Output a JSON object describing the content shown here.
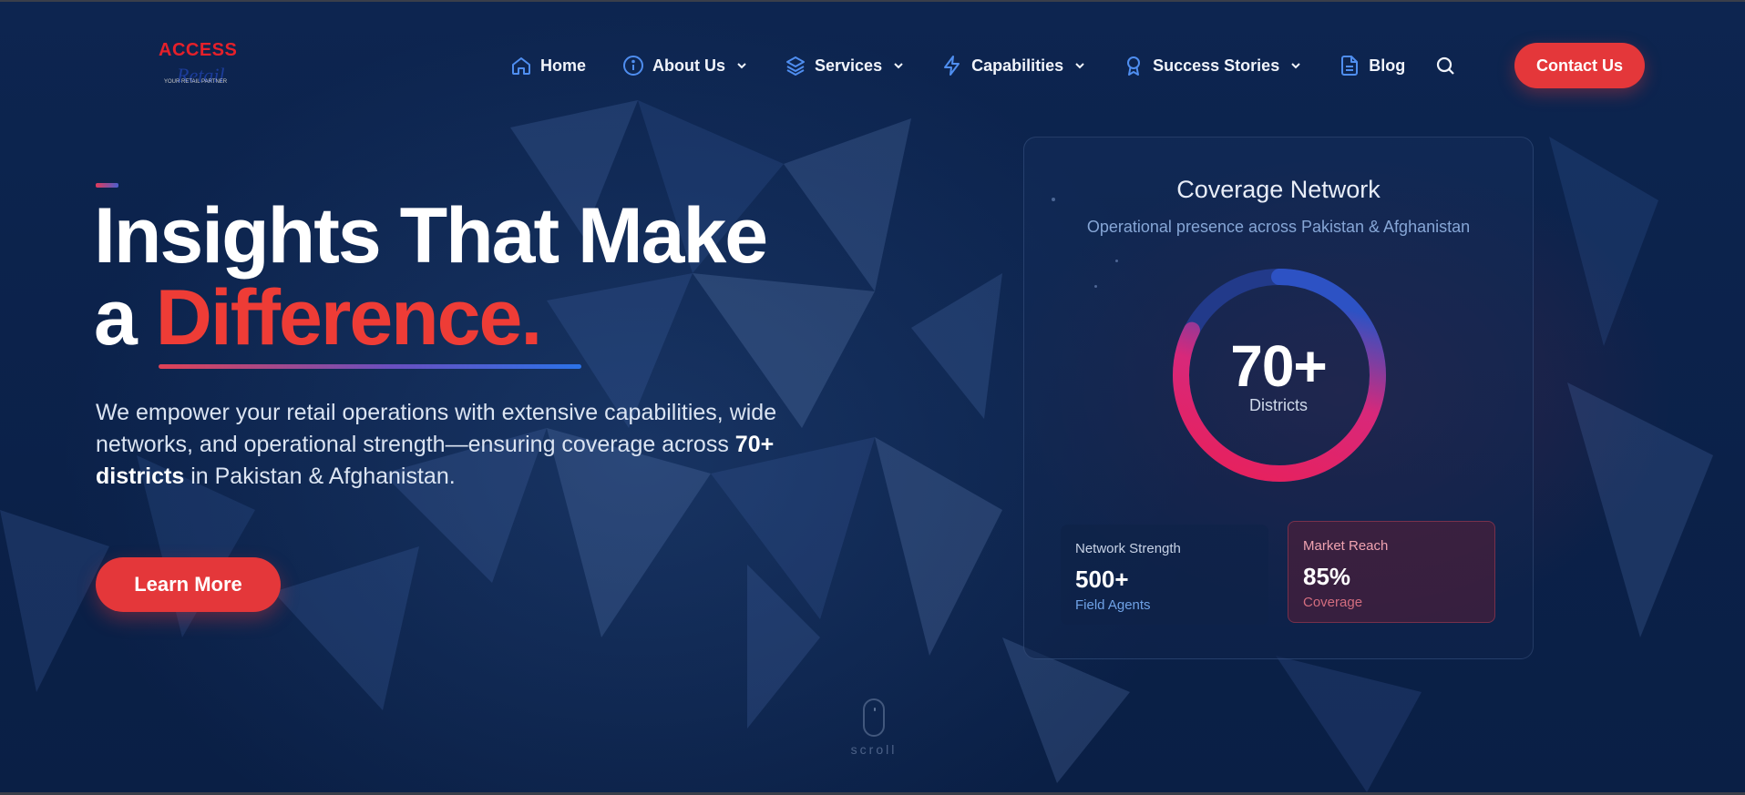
{
  "brand": {
    "logo_text": "ACCESS",
    "logo_script": "Retail",
    "logo_tagline": "YOUR RETAIL PARTNER"
  },
  "nav": {
    "items": [
      {
        "label": "Home",
        "icon": "home-icon",
        "dropdown": false
      },
      {
        "label": "About Us",
        "icon": "info-icon",
        "dropdown": true
      },
      {
        "label": "Services",
        "icon": "layers-icon",
        "dropdown": true
      },
      {
        "label": "Capabilities",
        "icon": "bolt-icon",
        "dropdown": true
      },
      {
        "label": "Success Stories",
        "icon": "award-icon",
        "dropdown": true
      },
      {
        "label": "Blog",
        "icon": "document-icon",
        "dropdown": false
      }
    ],
    "search_icon": "search-icon",
    "contact_label": "Contact Us"
  },
  "hero": {
    "headline_line1": "Insights That Make",
    "headline_a": "a",
    "headline_highlight": "Difference.",
    "paragraph_part1": "We empower your retail operations with extensive capabilities, wide networks, and operational strength—ensuring coverage across",
    "paragraph_bold": "70+ districts",
    "paragraph_part2": "in Pakistan & Afghanistan.",
    "cta_label": "Learn More"
  },
  "coverage_card": {
    "title": "Coverage Network",
    "subtitle": "Operational presence across Pakistan & Afghanistan",
    "ring_value": "70+",
    "ring_label": "Districts",
    "stats": [
      {
        "label": "Network Strength",
        "value": "500+",
        "unit": "Field Agents"
      },
      {
        "label": "Market Reach",
        "value": "85%",
        "unit": "Coverage"
      }
    ]
  },
  "scroll_hint": "scroll",
  "colors": {
    "accent_red": "#e4373a",
    "background": "#0c2147",
    "blue": "#2b72e8"
  }
}
